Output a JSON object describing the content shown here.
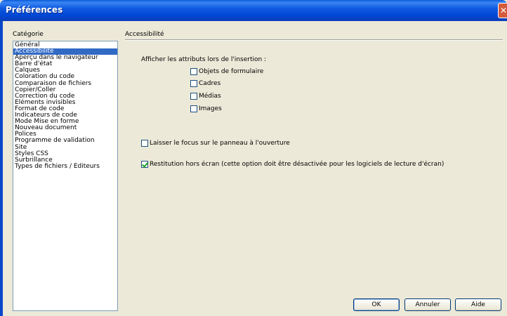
{
  "window": {
    "title": "Préférences",
    "close_glyph": "✕"
  },
  "category_label": "Catégorie",
  "categories": [
    "Général",
    "Accessibilité",
    "Aperçu dans le navigateur",
    "Barre d'état",
    "Calques",
    "Coloration du code",
    "Comparaison de fichiers",
    "Copier/Coller",
    "Correction du code",
    "Eléments invisibles",
    "Format de code",
    "Indicateurs de code",
    "Mode Mise en forme",
    "Nouveau document",
    "Polices",
    "Programme de validation",
    "Site",
    "Styles CSS",
    "Surbrillance",
    "Types de fichiers / Editeurs"
  ],
  "selected_category": "Accessibilité",
  "panel": {
    "title": "Accessibilité",
    "heading": "Afficher les attributs lors de l'insertion :",
    "insert_options": [
      {
        "label": "Objets de formulaire",
        "checked": false
      },
      {
        "label": "Cadres",
        "checked": false
      },
      {
        "label": "Médias",
        "checked": false
      },
      {
        "label": "Images",
        "checked": false
      }
    ],
    "focus_option": {
      "label": "Laisser le focus sur le panneau à l'ouverture",
      "checked": false
    },
    "offscreen_option": {
      "label": "Restitution hors écran (cette option doit être désactivée pour les logiciels de lecture d'écran)",
      "checked": true
    }
  },
  "buttons": {
    "ok": "OK",
    "cancel": "Annuler",
    "help": "Aide"
  }
}
